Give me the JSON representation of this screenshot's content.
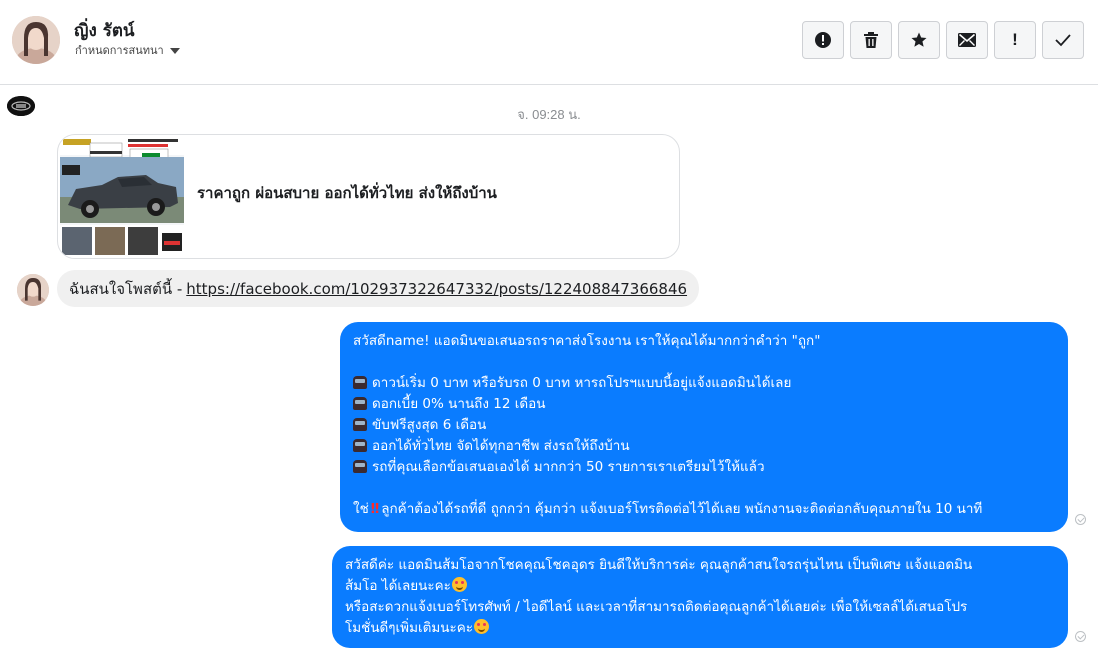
{
  "header": {
    "contact_name": "ญิ่ง รัตน์",
    "assign_label": "กำหนดการสนทนา",
    "toolbar": [
      {
        "name": "mark-spam-icon"
      },
      {
        "name": "trash-icon"
      },
      {
        "name": "star-icon"
      },
      {
        "name": "mark-unread-icon"
      },
      {
        "name": "priority-icon",
        "label": "!"
      },
      {
        "name": "done-check-icon"
      }
    ]
  },
  "conversation": {
    "timestamp": "จ. 09:28 น.",
    "link_card": {
      "title": "ราคาถูก ผ่อนสบาย ออกได้ทั่วไทย ส่งให้ถึงบ้าน"
    },
    "incoming": {
      "prefix": "ฉันสนใจโพสต์นี้ -",
      "link": "https://facebook.com/102937322647332/posts/122408847366846"
    },
    "outgoing_1": {
      "greeting": "สวัสดีname! แอดมินขอเสนอรถราคาส่งโรงงาน เราให้คุณได้มากกว่าคำว่า \"ถูก\"",
      "bullets": [
        "ดาวน์เริ่ม 0 บาท หรือรับรถ 0 บาท หารถโปรฯแบบนี้อยู่แจ้งแอดมินได้เลย",
        "ดอกเบี้ย 0% นานถึง 12 เดือน",
        "ขับฟรีสูงสุด 6 เดือน",
        "ออกได้ทั่วไทย จัดได้ทุกอาชีพ ส่งรถให้ถึงบ้าน",
        "รถที่คุณเลือกข้อเสนอเองได้ มากกว่า 50 รายการเราเตรียมไว้ให้แล้ว"
      ],
      "closing_prefix": "ใช่",
      "closing_text": "ลูกค้าต้องได้รถที่ดี ถูกกว่า คุ้มกว่า แจ้งเบอร์โทรติดต่อไว้ได้เลย พนักงานจะติดต่อกลับคุณภายใน 10 นาที"
    },
    "outgoing_2": {
      "line1": "สวัสดีค่ะ แอดมินส้มโอจากโชคคุณโชคอุดร ยินดีให้บริการค่ะ   คุณลูกค้าสนใจรถรุ่นไหน เป็นพิเศษ แจ้งแอดมิน",
      "line2": "ส้มโอ ได้เลยนะคะ",
      "line3": "หรือสะดวกแจ้งเบอร์โทรศัพท์ / ไอดีไลน์ และเวลาที่สามารถติดต่อคุณลูกค้าได้เลยค่ะ เพื่อให้เซลล์ได้เสนอโปร",
      "line4": "โมชั่นดีๆเพิ่มเติมนะคะ"
    }
  }
}
